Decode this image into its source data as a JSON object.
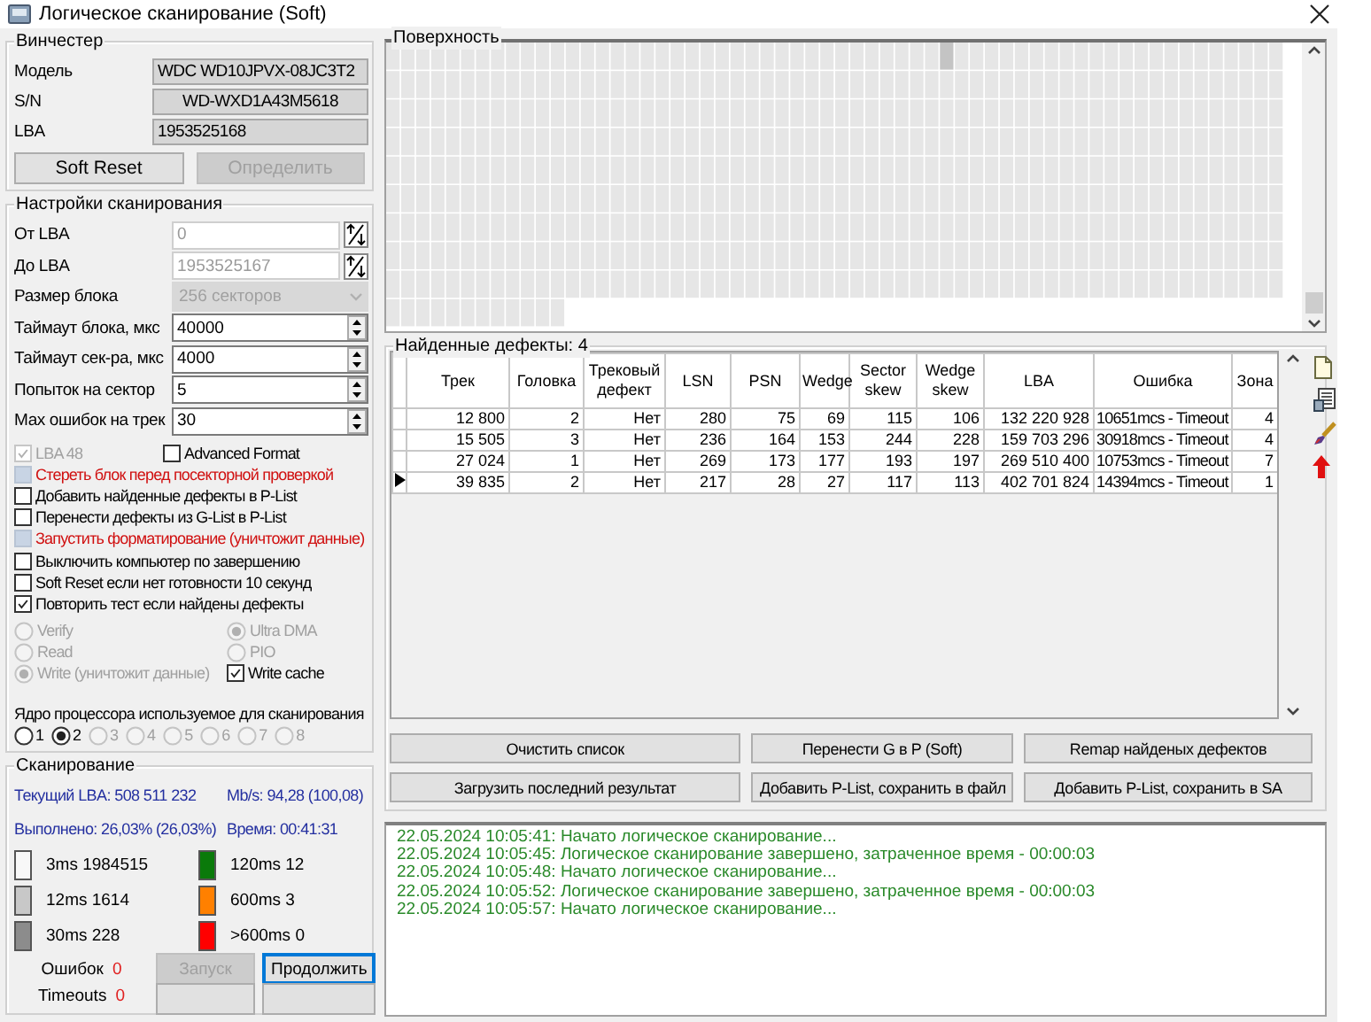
{
  "window": {
    "title": "Логическое сканирование (Soft)"
  },
  "drive": {
    "title": "Винчестер",
    "fields": [
      {
        "label": "Модель",
        "value": "WDC WD10JPVX-08JC3T2",
        "centered": false
      },
      {
        "label": "S/N",
        "value": "WD-WXD1A43M5618",
        "centered": true
      },
      {
        "label": "LBA",
        "value": "1953525168",
        "centered": false
      }
    ],
    "buttons": [
      {
        "label": "Soft Reset",
        "disabled": false
      },
      {
        "label": "Определить",
        "disabled": true
      }
    ]
  },
  "settings": {
    "title": "Настройки сканирования",
    "fields": [
      {
        "kind": "lba",
        "label": "От LBA",
        "value": "0",
        "disabled": true
      },
      {
        "kind": "lba",
        "label": "До LBA",
        "value": "1953525167",
        "disabled": true
      },
      {
        "kind": "combo",
        "label": "Размер блока",
        "value": "256 секторов",
        "disabled": true
      },
      {
        "kind": "spin",
        "label": "Таймаут блока, мкс",
        "value": "40000",
        "disabled": false
      },
      {
        "kind": "spin",
        "label": "Таймаут сек-ра, мкс",
        "value": "4000",
        "disabled": false
      },
      {
        "kind": "spin",
        "label": "Попыток на сектор",
        "value": "5",
        "disabled": false
      },
      {
        "kind": "spin",
        "label": "Мах ошибок на трек",
        "value": "30",
        "disabled": false
      }
    ],
    "format_checks": [
      {
        "label": "LBA 48",
        "checked": true,
        "disabled": true
      },
      {
        "label": "Advanced Format",
        "checked": false,
        "disabled": false
      }
    ],
    "options": [
      {
        "label": "Стереть блок перед посекторной проверкой",
        "checked": false,
        "disabled": true,
        "warning": true
      },
      {
        "label": "Добавить найденные дефекты в P-List",
        "checked": false,
        "disabled": false,
        "warning": false
      },
      {
        "label": "Перенести дефекты из G-List в P-List",
        "checked": false,
        "disabled": false,
        "warning": false
      },
      {
        "label": "Запустить форматирование (уничтожит данные)",
        "checked": false,
        "disabled": true,
        "warning": true
      },
      {
        "label": "Выключить компьютер по завершению",
        "checked": false,
        "disabled": false,
        "warning": false
      },
      {
        "label": "Soft Reset если нет готовности 10 секунд",
        "checked": false,
        "disabled": false,
        "warning": false
      },
      {
        "label": "Повторить тест если найдены дефекты",
        "checked": true,
        "disabled": false,
        "warning": false
      }
    ],
    "access_modes": [
      {
        "label": "Verify",
        "selected": false,
        "disabled": true
      },
      {
        "label": "Read",
        "selected": false,
        "disabled": true
      },
      {
        "label": "Write (уничтожит данные)",
        "selected": true,
        "disabled": true
      }
    ],
    "transfer_modes": [
      {
        "label": "Ultra DMA",
        "selected": true,
        "disabled": true
      },
      {
        "label": "PIO",
        "selected": false,
        "disabled": true
      }
    ],
    "write_cache": {
      "label": "Write cache",
      "checked": true
    },
    "cores": {
      "label": "Ядро процессора используемое для сканирования",
      "options": [
        {
          "label": "1",
          "selected": false,
          "disabled": false
        },
        {
          "label": "2",
          "selected": true,
          "disabled": false
        },
        {
          "label": "3",
          "selected": false,
          "disabled": true
        },
        {
          "label": "4",
          "selected": false,
          "disabled": true
        },
        {
          "label": "5",
          "selected": false,
          "disabled": true
        },
        {
          "label": "6",
          "selected": false,
          "disabled": true
        },
        {
          "label": "7",
          "selected": false,
          "disabled": true
        },
        {
          "label": "8",
          "selected": false,
          "disabled": true
        }
      ]
    }
  },
  "scan": {
    "title": "Сканирование",
    "stats": [
      "Текущий LBA: 508 511 232",
      "Mb/s: 94,28 (100,08)",
      "Выполнено: 26,03% (26,03%)",
      "Время: 00:41:31"
    ],
    "legend": [
      {
        "label": "3ms 1984515",
        "color": "#f8f8f8"
      },
      {
        "label": "12ms 1614",
        "color": "#c8c8c8"
      },
      {
        "label": "30ms 228",
        "color": "#8c8c8c"
      },
      {
        "label": "120ms 12",
        "color": "#0a7a0a"
      },
      {
        "label": "600ms 3",
        "color": "#ff8000"
      },
      {
        "label": ">600ms 0",
        "color": "#ff0000"
      }
    ],
    "counters": [
      {
        "label": "Ошибок",
        "value": "0"
      },
      {
        "label": "Timeouts",
        "value": "0"
      }
    ],
    "buttons": [
      {
        "label": "Запуск",
        "disabled": true
      },
      {
        "label": "Продолжить",
        "disabled": false
      }
    ]
  },
  "surface": {
    "title": "Поверхность"
  },
  "defects": {
    "title": "Найденные дефекты: 4",
    "columns": [
      "Трек",
      "Головка",
      "Трековый дефект",
      "LSN",
      "PSN",
      "Wedge",
      "Sector skew",
      "Wedge skew",
      "LBA",
      "Ошибка",
      "Зона"
    ],
    "rows": [
      {
        "selected": false,
        "cells": [
          "12 800",
          "2",
          "Нет",
          "280",
          "75",
          "69",
          "115",
          "106",
          "132 220 928",
          "10651mcs - Timeout",
          "4"
        ]
      },
      {
        "selected": false,
        "cells": [
          "15 505",
          "3",
          "Нет",
          "236",
          "164",
          "153",
          "244",
          "228",
          "159 703 296",
          "30918mcs - Timeout",
          "4"
        ]
      },
      {
        "selected": false,
        "cells": [
          "27 024",
          "1",
          "Нет",
          "269",
          "173",
          "177",
          "193",
          "197",
          "269 510 400",
          "10753mcs - Timeout",
          "7"
        ]
      },
      {
        "selected": true,
        "cells": [
          "39 835",
          "2",
          "Нет",
          "217",
          "28",
          "27",
          "117",
          "113",
          "402 701 824",
          "14394mcs - Timeout",
          "1"
        ]
      }
    ],
    "buttons": [
      "Очистить список",
      "Перенести G в P (Soft)",
      "Remap найденых дефектов",
      "Загрузить последний результат",
      "Добавить P-List, сохранить в файл",
      "Добавить P-List, сохранить в SA"
    ]
  },
  "log": [
    "22.05.2024 10:05:41: Начато логическое сканирование...",
    "22.05.2024 10:05:45: Логическое сканирование завершено, затраченное время - 00:00:03",
    "22.05.2024 10:05:48: Начато логическое сканирование...",
    "22.05.2024 10:05:52: Логическое сканирование завершено, затраченное время - 00:00:03",
    "22.05.2024 10:05:57: Начато логическое сканирование..."
  ]
}
